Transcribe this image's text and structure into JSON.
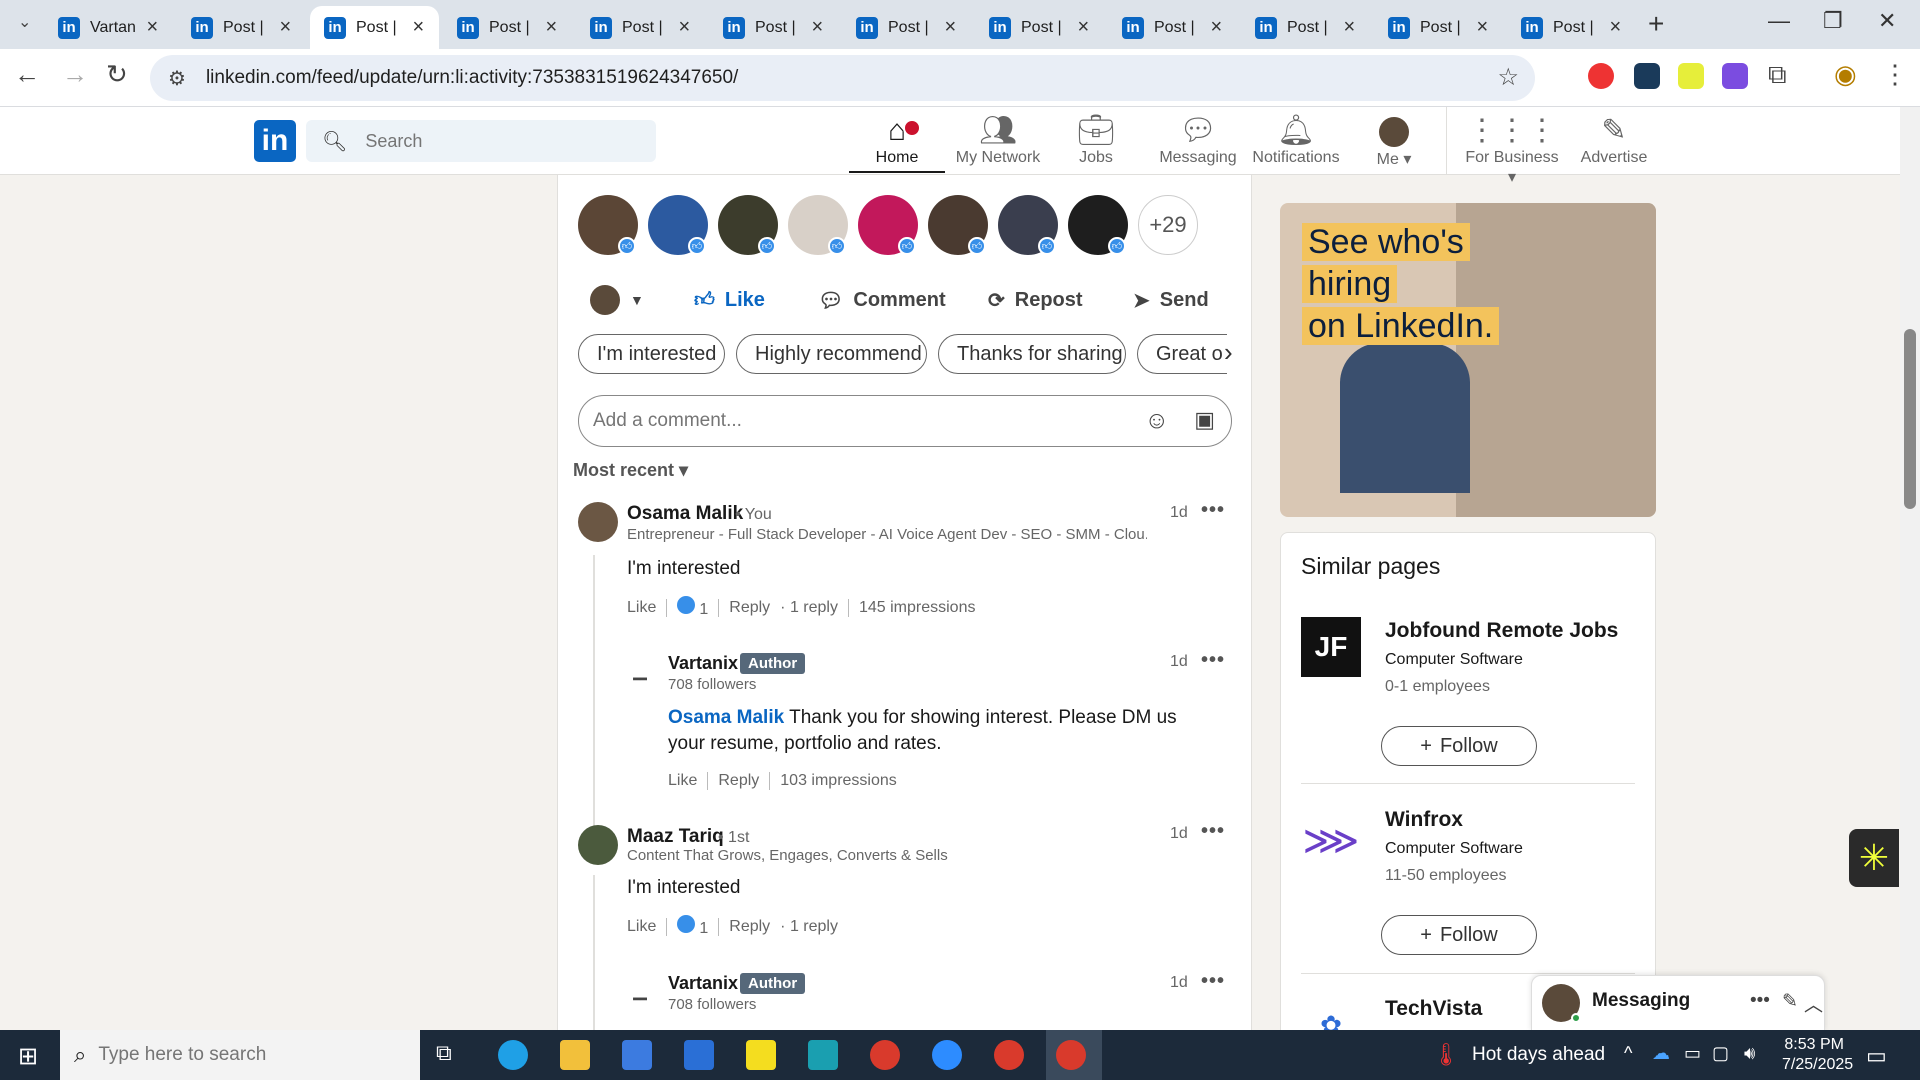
{
  "browser": {
    "tabs": [
      {
        "label": "Vartan"
      },
      {
        "label": "Post | F"
      },
      {
        "label": "Post | F"
      },
      {
        "label": "Post | F"
      },
      {
        "label": "Post | F"
      },
      {
        "label": "Post | F"
      },
      {
        "label": "Post | F"
      },
      {
        "label": "Post | F"
      },
      {
        "label": "Post | F"
      },
      {
        "label": "Post | F"
      },
      {
        "label": "Post | F"
      },
      {
        "label": "Post | F"
      }
    ],
    "active_tab_index": 2,
    "url": "linkedin.com/feed/update/urn:li:activity:7353831519624347650/"
  },
  "linkedin_header": {
    "search_placeholder": "Search",
    "nav": [
      {
        "label": "Home",
        "icon": "home-icon"
      },
      {
        "label": "My Network",
        "icon": "network-icon"
      },
      {
        "label": "Jobs",
        "icon": "briefcase-icon"
      },
      {
        "label": "Messaging",
        "icon": "messaging-icon"
      },
      {
        "label": "Notifications",
        "icon": "bell-icon"
      },
      {
        "label": "Me",
        "icon": "avatar"
      },
      {
        "label": "For Business",
        "icon": "grid-icon"
      },
      {
        "label": "Advertise",
        "icon": "advertise-icon"
      }
    ]
  },
  "post": {
    "more_reactors": "+29",
    "actions": {
      "like": "Like",
      "comment": "Comment",
      "repost": "Repost",
      "send": "Send"
    },
    "suggestion_chips": [
      "I'm interested",
      "Highly recommend",
      "Thanks for sharing",
      "Great o"
    ],
    "comment_placeholder": "Add a comment...",
    "sort_label": "Most recent"
  },
  "comments": [
    {
      "name": "Osama Malik",
      "relation": "• You",
      "headline": "Entrepreneur - Full Stack Developer - AI Voice Agent Dev - SEO - SMM - Clou...",
      "time": "1d",
      "text": "I'm interested",
      "like": "Like",
      "like_count": "1",
      "reply": "Reply",
      "reply_count": "· 1 reply",
      "impressions": "145 impressions",
      "reply_item": {
        "name": "Vartanix",
        "badge": "Author",
        "followers": "708 followers",
        "time": "1d",
        "mention": "Osama Malik",
        "text": " Thank you for showing interest. Please DM us your resume, portfolio and rates.",
        "like": "Like",
        "reply": "Reply",
        "impressions": "103 impressions"
      }
    },
    {
      "name": "Maaz Tariq",
      "relation": "• 1st",
      "headline": "Content That Grows, Engages, Converts & Sells",
      "time": "1d",
      "text": "I'm interested",
      "like": "Like",
      "like_count": "1",
      "reply": "Reply",
      "reply_count": "· 1 reply",
      "reply_item": {
        "name": "Vartanix",
        "badge": "Author",
        "followers": "708 followers",
        "time": "1d"
      }
    }
  ],
  "ad": {
    "line1": "See who's hiring",
    "line2": "on LinkedIn."
  },
  "similar_pages": {
    "title": "Similar pages",
    "items": [
      {
        "name": "Jobfound Remote Jobs",
        "industry": "Computer Software",
        "employees": "0-1 employees",
        "logo": "JF",
        "follow": "Follow"
      },
      {
        "name": "Winfrox",
        "industry": "Computer Software",
        "employees": "11-50 employees",
        "follow": "Follow"
      },
      {
        "name": "TechVista"
      }
    ]
  },
  "messaging": {
    "title": "Messaging"
  },
  "taskbar": {
    "search_placeholder": "Type here to search",
    "weather": "Hot days ahead",
    "time": "8:53 PM",
    "date": "7/25/2025"
  },
  "colors": {
    "linkedin_blue": "#0a66c2",
    "like_blue": "#378fe9"
  }
}
